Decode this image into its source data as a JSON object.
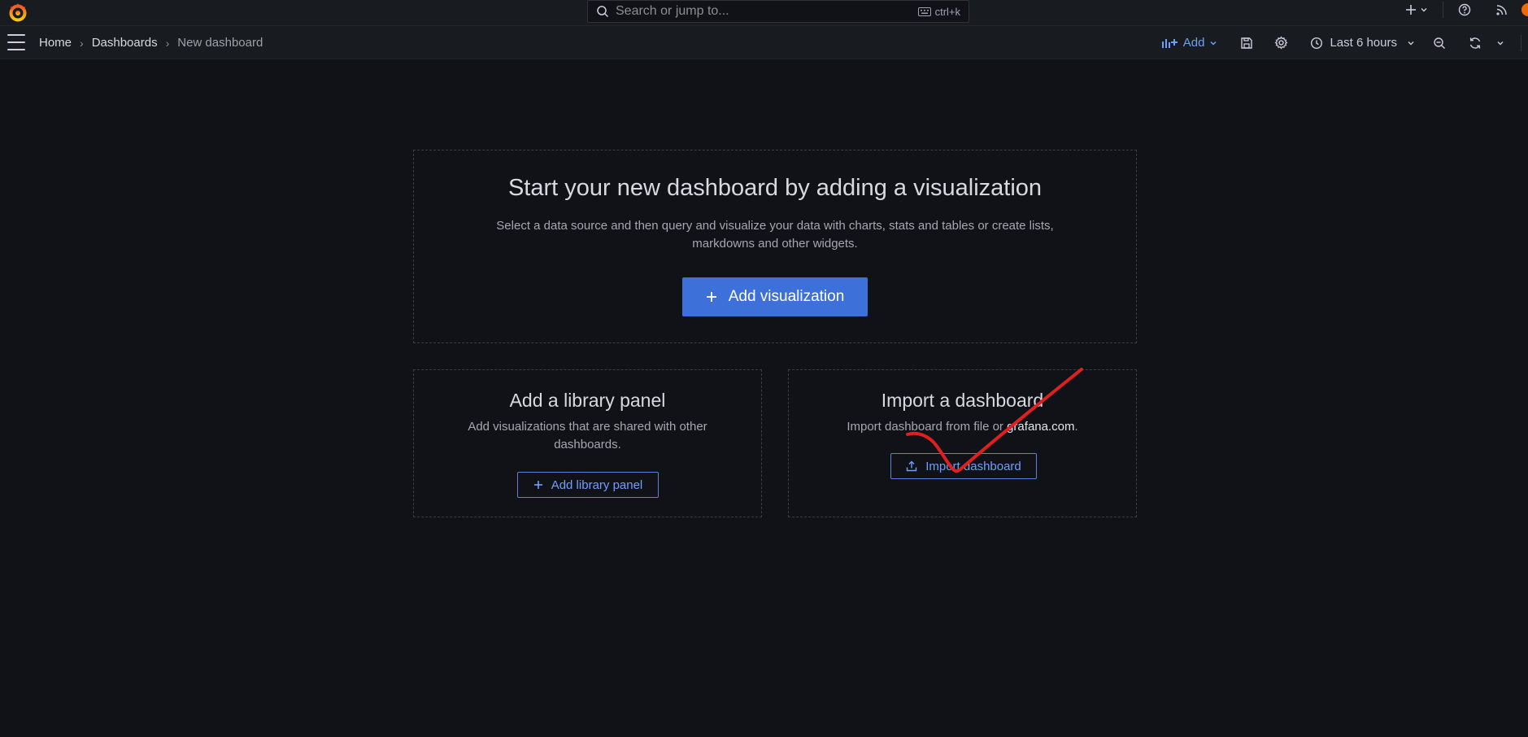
{
  "topbar": {
    "search_placeholder": "Search or jump to...",
    "search_shortcut": "ctrl+k"
  },
  "navbar": {
    "breadcrumbs": [
      "Home",
      "Dashboards",
      "New dashboard"
    ],
    "add_label": "Add",
    "time_range": "Last 6 hours"
  },
  "hero": {
    "title": "Start your new dashboard by adding a visualization",
    "description": "Select a data source and then query and visualize your data with charts, stats and tables or create lists, markdowns and other widgets.",
    "button_label": "Add visualization"
  },
  "library_panel": {
    "title": "Add a library panel",
    "description": "Add visualizations that are shared with other dashboards.",
    "button_label": "Add library panel"
  },
  "import_dashboard": {
    "title": "Import a dashboard",
    "description_prefix": "Import dashboard from file or ",
    "description_link": "grafana.com",
    "description_suffix": ".",
    "button_label": "Import dashboard"
  },
  "colors": {
    "background": "#111217",
    "bar": "#181b1f",
    "primary": "#3d71d9",
    "link": "#6e9fff",
    "annotation": "#e02020",
    "logo": "#f46800"
  }
}
